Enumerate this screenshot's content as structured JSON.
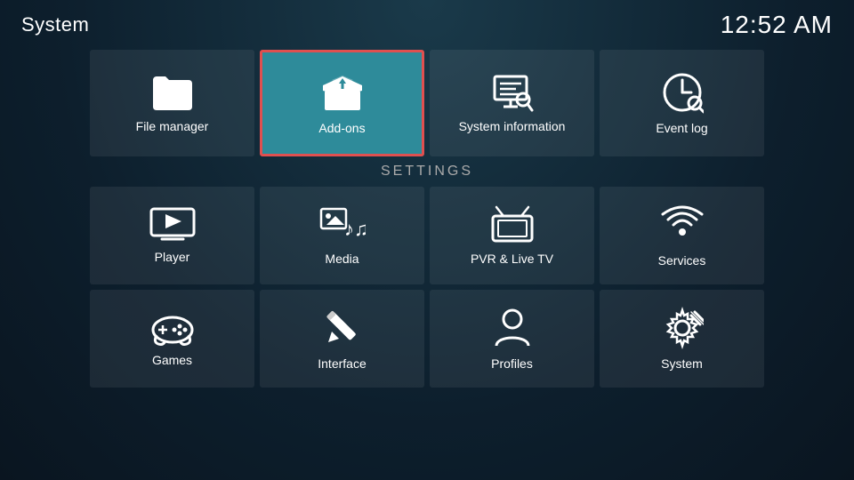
{
  "topBar": {
    "title": "System",
    "time": "12:52 AM"
  },
  "topRow": [
    {
      "id": "file-manager",
      "label": "File manager",
      "icon": "folder"
    },
    {
      "id": "add-ons",
      "label": "Add-ons",
      "icon": "addons",
      "active": true
    },
    {
      "id": "system-information",
      "label": "System information",
      "icon": "sysinfo"
    },
    {
      "id": "event-log",
      "label": "Event log",
      "icon": "eventlog"
    }
  ],
  "settingsSection": {
    "title": "Settings",
    "row1": [
      {
        "id": "player",
        "label": "Player",
        "icon": "player"
      },
      {
        "id": "media",
        "label": "Media",
        "icon": "media"
      },
      {
        "id": "pvr-live-tv",
        "label": "PVR & Live TV",
        "icon": "pvr"
      },
      {
        "id": "services",
        "label": "Services",
        "icon": "services"
      }
    ],
    "row2": [
      {
        "id": "games",
        "label": "Games",
        "icon": "games"
      },
      {
        "id": "interface",
        "label": "Interface",
        "icon": "interface"
      },
      {
        "id": "profiles",
        "label": "Profiles",
        "icon": "profiles"
      },
      {
        "id": "system",
        "label": "System",
        "icon": "systemsettings"
      }
    ]
  }
}
